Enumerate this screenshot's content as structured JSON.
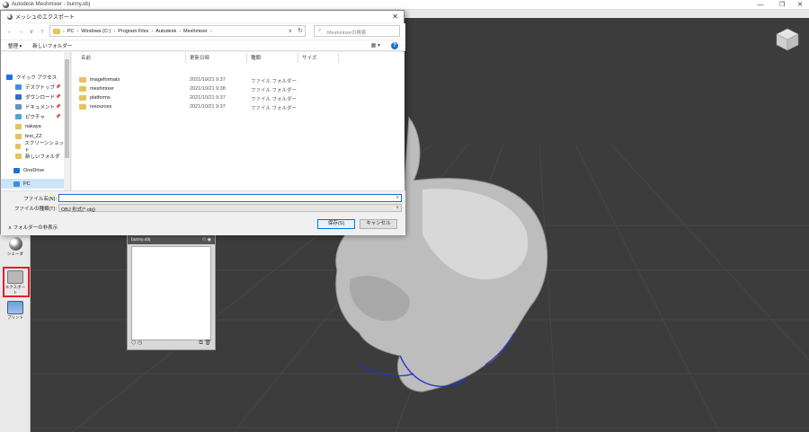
{
  "app": {
    "title": "Autodesk Meshmixer - bunny.obj",
    "minimize": "—",
    "restore": "❐",
    "close": "✕"
  },
  "left_toolbar": {
    "items": [
      {
        "label": "シェーダ",
        "icon": "shader-sphere-icon"
      },
      {
        "label": "エクスポート",
        "icon": "export-icon"
      },
      {
        "label": "プリント",
        "icon": "print-icon"
      }
    ]
  },
  "object_browser": {
    "object_name": "bunny.obj"
  },
  "dialog": {
    "title": "メッシュのエクスポート",
    "close": "✕",
    "nav": {
      "back": "←",
      "forward": "→",
      "recent": "∨",
      "up": "↑"
    },
    "breadcrumb": [
      "PC",
      "Windows (C:)",
      "Program Files",
      "Autodesk",
      "Meshmixer"
    ],
    "crumb_separator": "›",
    "search_placeholder": "Meshmixerの検索",
    "toolbar": {
      "organize": "整理 ▾",
      "new_folder": "新しいフォルダー",
      "view": "▦ ▾",
      "help": "?"
    },
    "nav_pane": [
      {
        "label": "クイック アクセス",
        "icon": "star-icon",
        "color": "#1e6fd9",
        "pin": ""
      },
      {
        "label": "デスクトップ",
        "icon": "desktop-icon",
        "color": "#3a8ee6",
        "pin": "📌"
      },
      {
        "label": "ダウンロード",
        "icon": "download-icon",
        "color": "#2a6fd0",
        "pin": "📌"
      },
      {
        "label": "ドキュメント",
        "icon": "document-icon",
        "color": "#6b8fbf",
        "pin": "📌"
      },
      {
        "label": "ピクチャ",
        "icon": "picture-icon",
        "color": "#4aa3df",
        "pin": "📌"
      },
      {
        "label": "nakaya",
        "icon": "folder-icon",
        "color": "#e7c25a",
        "pin": ""
      },
      {
        "label": "test_ZZ",
        "icon": "folder-icon",
        "color": "#e7c25a",
        "pin": ""
      },
      {
        "label": "スクリーンショット",
        "icon": "folder-icon",
        "color": "#e7c25a",
        "pin": ""
      },
      {
        "label": "新しいフォルダ",
        "icon": "folder-icon",
        "color": "#e7c25a",
        "pin": ""
      },
      {
        "label": "OneDrive",
        "icon": "cloud-icon",
        "color": "#1e6fd9",
        "pin": ""
      },
      {
        "label": "PC",
        "icon": "pc-icon",
        "color": "#3a8ee6",
        "pin": ""
      }
    ],
    "columns": {
      "name": "名前",
      "date": "更新日時",
      "type": "種類",
      "size": "サイズ"
    },
    "files": [
      {
        "name": "imageformats",
        "date": "2021/10/21 9:37",
        "type": "ファイル フォルダー"
      },
      {
        "name": "meshmixer",
        "date": "2021/10/21 9:38",
        "type": "ファイル フォルダー"
      },
      {
        "name": "platforms",
        "date": "2021/10/21 9:37",
        "type": "ファイル フォルダー"
      },
      {
        "name": "resources",
        "date": "2021/10/21 9:37",
        "type": "ファイル フォルダー"
      }
    ],
    "filename_label": "ファイル名(N):",
    "filename_value": "",
    "filetype_label": "ファイルの種類(T):",
    "filetype_value": "OBJ 形式(*.obj)",
    "hide_folders": "フォルダーの非表示",
    "save_button": "保存(S)",
    "cancel_button": "キャンセル"
  }
}
